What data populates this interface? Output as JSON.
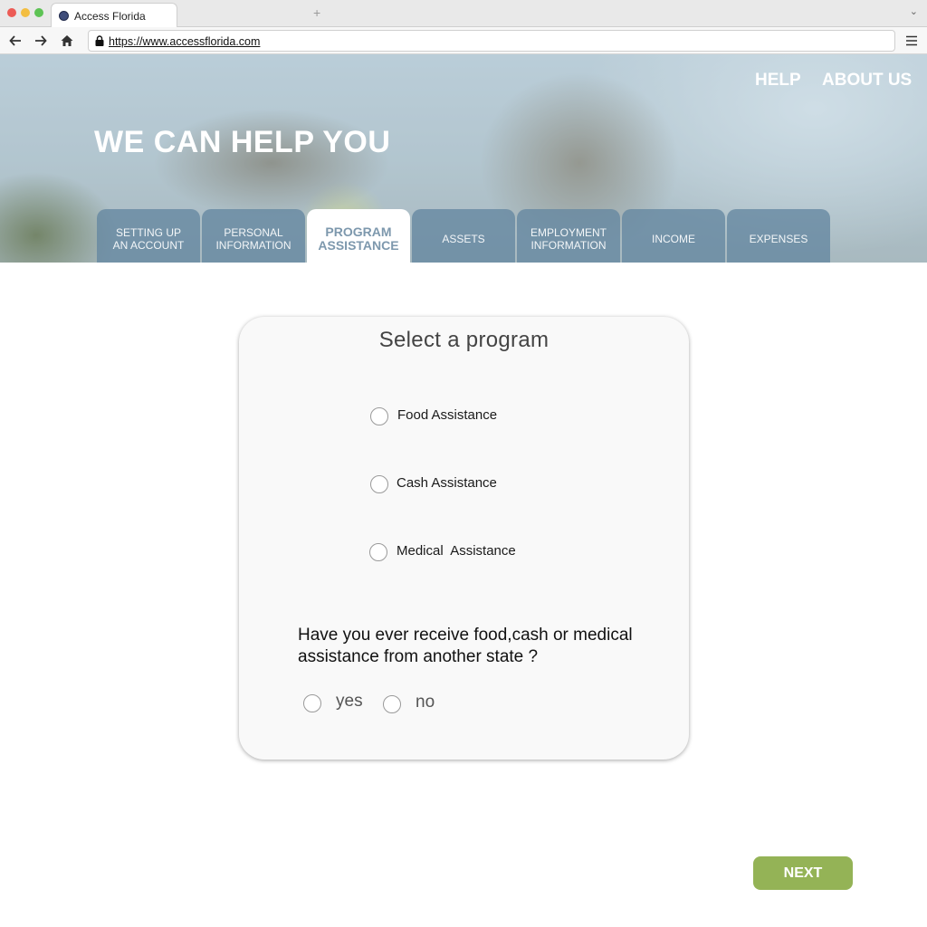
{
  "browser": {
    "tab_title": "Access  Florida",
    "new_tab_symbol": "+",
    "url": "https://www.accessflorida.com"
  },
  "header": {
    "title": "WE CAN HELP YOU",
    "links": {
      "help": "HELP",
      "about": "ABOUT US"
    }
  },
  "steps": [
    {
      "line1": "SETTING UP",
      "line2": "AN ACCOUNT",
      "active": false
    },
    {
      "line1": "PERSONAL",
      "line2": "INFORMATION",
      "active": false
    },
    {
      "line1": "PROGRAM",
      "line2": "ASSISTANCE",
      "active": true
    },
    {
      "line1": "ASSETS",
      "line2": "",
      "active": false
    },
    {
      "line1": "EMPLOYMENT",
      "line2": "INFORMATION",
      "active": false
    },
    {
      "line1": "INCOME",
      "line2": "",
      "active": false
    },
    {
      "line1": "EXPENSES",
      "line2": "",
      "active": false
    }
  ],
  "form": {
    "title": "Select  a program",
    "programs": [
      "Food Assistance",
      "Cash Assistance",
      "Medical  Assistance"
    ],
    "question": "Have you ever receive food,cash or medical assistance from another state ?",
    "answers": {
      "yes": "yes",
      "no": "no"
    }
  },
  "next_label": "NEXT",
  "colors": {
    "accent_green": "#94b356",
    "tab_blue": "#6487a0",
    "active_tab_text": "#7d98ad"
  }
}
